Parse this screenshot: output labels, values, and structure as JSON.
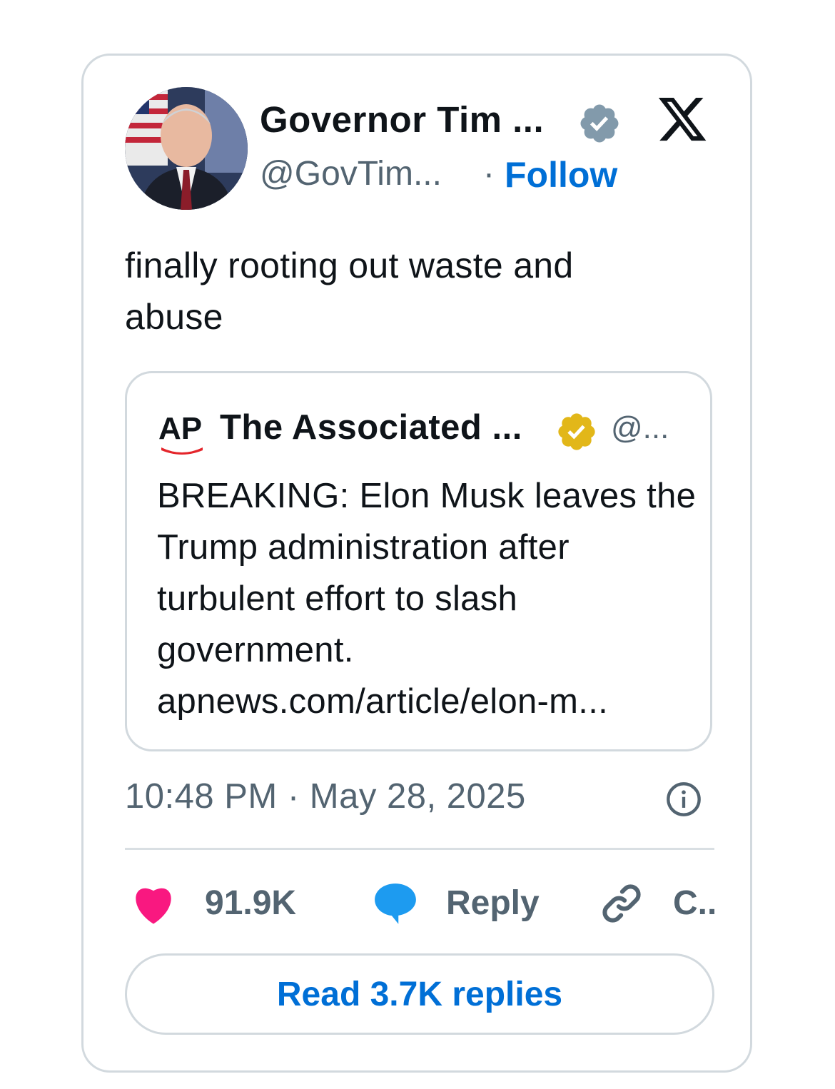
{
  "author": {
    "name": "Governor Tim ...",
    "handle": "@GovTim...",
    "separator": "·",
    "follow_label": "Follow"
  },
  "tweet": {
    "text": "finally rooting out waste and abuse"
  },
  "quoted": {
    "source_logo_text": "AP",
    "name": "The Associated ...",
    "handle": "@...",
    "text": "BREAKING: Elon Musk leaves the Trump administration after turbulent effort to slash government.",
    "link": "apnews.com/article/elon-m..."
  },
  "meta": {
    "timestamp": "10:48 PM · May 28, 2025"
  },
  "actions": {
    "like_count": "91.9K",
    "reply_label": "Reply",
    "copy_label": "C..."
  },
  "read_replies_label": "Read 3.7K replies",
  "colors": {
    "accent": "#006fd6",
    "like": "#f91880",
    "reply": "#1d9bf0",
    "verified_gray": "#829aab",
    "verified_gold": "#e2b719",
    "ap_red": "#e4252b"
  },
  "icons": {
    "platform": "x-logo-icon",
    "verified": "verified-badge-icon",
    "org_verified": "gold-verified-badge-icon",
    "info": "info-icon",
    "like": "heart-icon",
    "reply": "speech-bubble-icon",
    "copy": "link-icon"
  }
}
